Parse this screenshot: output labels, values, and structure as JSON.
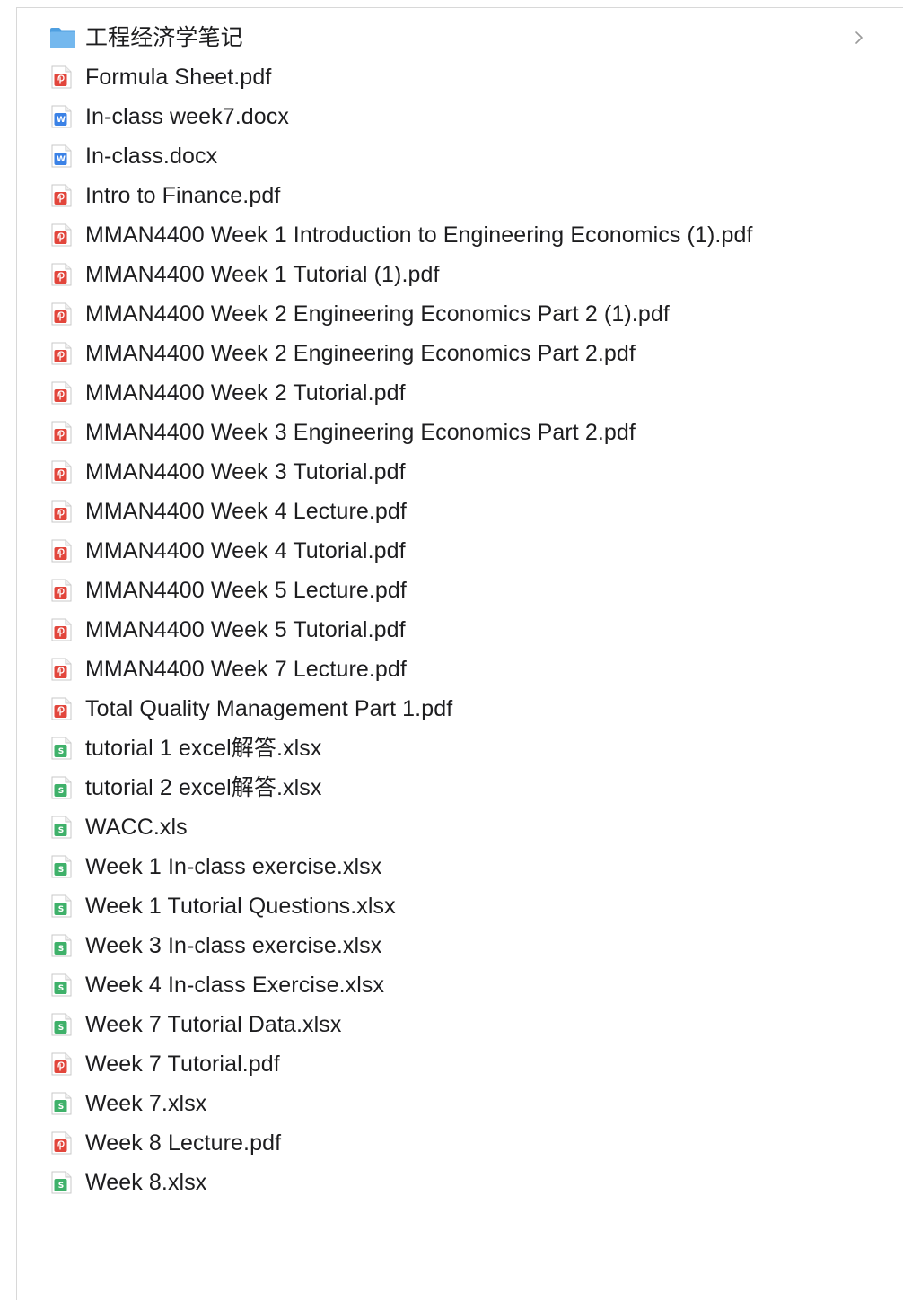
{
  "folder": {
    "name": "工程经济学笔记",
    "icon": "folder-icon",
    "color": "#5aa9e6"
  },
  "files": [
    {
      "name": "Formula Sheet.pdf",
      "type": "pdf"
    },
    {
      "name": "In-class week7.docx",
      "type": "docx"
    },
    {
      "name": "In-class.docx",
      "type": "docx"
    },
    {
      "name": "Intro to Finance.pdf",
      "type": "pdf"
    },
    {
      "name": "MMAN4400 Week 1 Introduction to Engineering Economics (1).pdf",
      "type": "pdf"
    },
    {
      "name": "MMAN4400 Week 1 Tutorial (1).pdf",
      "type": "pdf"
    },
    {
      "name": "MMAN4400 Week 2 Engineering Economics Part 2 (1).pdf",
      "type": "pdf"
    },
    {
      "name": "MMAN4400 Week 2 Engineering Economics Part 2.pdf",
      "type": "pdf"
    },
    {
      "name": "MMAN4400 Week 2 Tutorial.pdf",
      "type": "pdf"
    },
    {
      "name": "MMAN4400 Week 3 Engineering Economics Part 2.pdf",
      "type": "pdf"
    },
    {
      "name": "MMAN4400 Week 3 Tutorial.pdf",
      "type": "pdf"
    },
    {
      "name": "MMAN4400 Week 4 Lecture.pdf",
      "type": "pdf"
    },
    {
      "name": "MMAN4400 Week 4 Tutorial.pdf",
      "type": "pdf"
    },
    {
      "name": "MMAN4400 Week 5 Lecture.pdf",
      "type": "pdf"
    },
    {
      "name": "MMAN4400 Week 5 Tutorial.pdf",
      "type": "pdf"
    },
    {
      "name": "MMAN4400 Week 7 Lecture.pdf",
      "type": "pdf"
    },
    {
      "name": "Total Quality Management Part 1.pdf",
      "type": "pdf"
    },
    {
      "name": "tutorial 1 excel解答.xlsx",
      "type": "xlsx"
    },
    {
      "name": "tutorial 2 excel解答.xlsx",
      "type": "xlsx"
    },
    {
      "name": "WACC.xls",
      "type": "xlsx"
    },
    {
      "name": "Week 1 In-class exercise.xlsx",
      "type": "xlsx"
    },
    {
      "name": "Week 1 Tutorial Questions.xlsx",
      "type": "xlsx"
    },
    {
      "name": "Week 3 In-class exercise.xlsx",
      "type": "xlsx"
    },
    {
      "name": "Week 4 In-class Exercise.xlsx",
      "type": "xlsx"
    },
    {
      "name": "Week 7 Tutorial Data.xlsx",
      "type": "xlsx"
    },
    {
      "name": "Week 7 Tutorial.pdf",
      "type": "pdf"
    },
    {
      "name": "Week 7.xlsx",
      "type": "xlsx"
    },
    {
      "name": "Week 8 Lecture.pdf",
      "type": "pdf"
    },
    {
      "name": "Week 8.xlsx",
      "type": "xlsx"
    }
  ],
  "icon_colors": {
    "pdf": "#e2463c",
    "docx": "#3b82e6",
    "xlsx": "#3fb16a"
  }
}
